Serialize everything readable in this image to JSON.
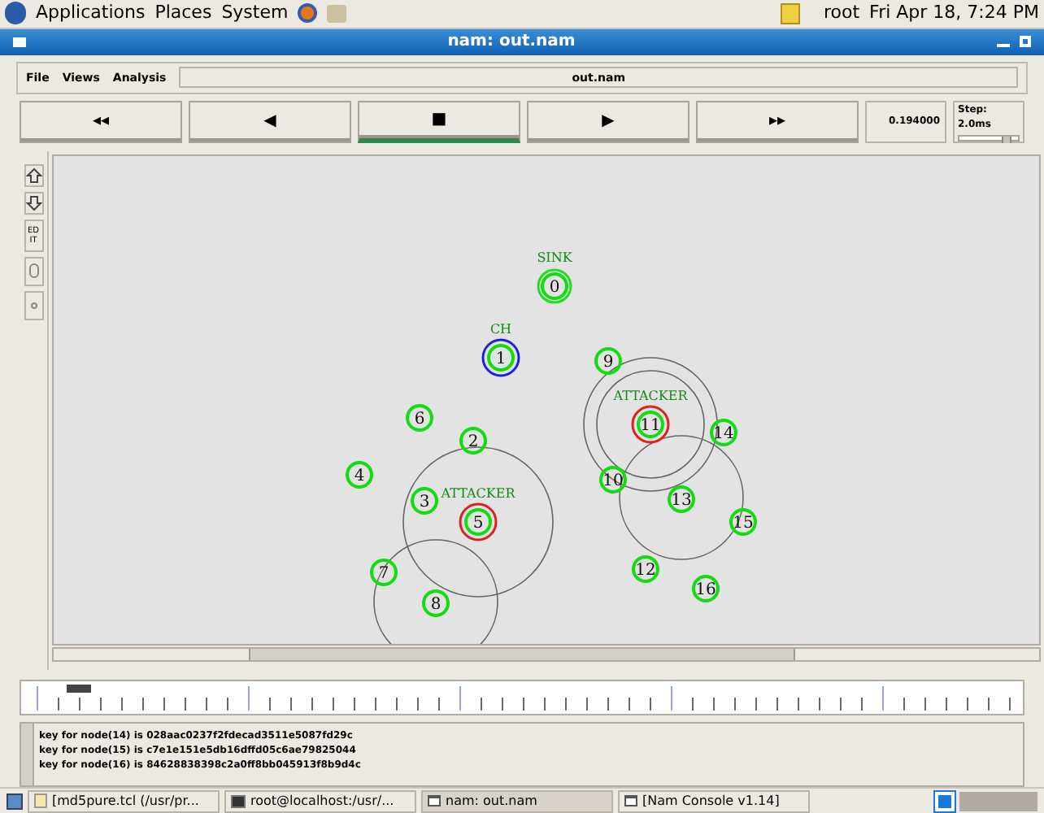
{
  "top_panel": {
    "menus": [
      "Applications",
      "Places",
      "System"
    ],
    "user": "root",
    "clock": "Fri Apr 18,  7:24 PM"
  },
  "window": {
    "title": "nam: out.nam"
  },
  "menu_bar": {
    "items": [
      "File",
      "Views",
      "Analysis"
    ],
    "file_name": "out.nam"
  },
  "controls": {
    "buttons": [
      {
        "label": "◂◂",
        "selected": false
      },
      {
        "label": "◀",
        "selected": false
      },
      {
        "label": "■",
        "selected": true
      },
      {
        "label": "▶",
        "selected": false
      },
      {
        "label": "▸▸",
        "selected": false
      }
    ],
    "time": "0.194000",
    "step": "Step: 2.0ms",
    "step_slider": {
      "level": 0.75
    }
  },
  "tools": [
    {
      "kind": "zoom-in"
    },
    {
      "kind": "zoom-out"
    },
    {
      "kind": "edit",
      "label": "ED IT"
    },
    {
      "kind": "big-circle"
    },
    {
      "kind": "small-circle"
    }
  ],
  "nodes": [
    {
      "label": "0",
      "tag": "SINK",
      "kind": "sink"
    },
    {
      "label": "1",
      "tag": "CH",
      "kind": "head"
    },
    {
      "label": "9",
      "kind": "normal"
    },
    {
      "label": "6",
      "kind": "normal"
    },
    {
      "label": "11",
      "tag": "ATTACKER",
      "kind": "attacker"
    },
    {
      "label": "2",
      "kind": "normal"
    },
    {
      "label": "14",
      "kind": "normal"
    },
    {
      "label": "4",
      "kind": "normal"
    },
    {
      "label": "10",
      "kind": "normal"
    },
    {
      "label": "3",
      "kind": "normal"
    },
    {
      "label": "5",
      "tag": "ATTACKER",
      "kind": "attacker"
    },
    {
      "label": "13",
      "kind": "normal"
    },
    {
      "label": "15",
      "kind": "normal"
    },
    {
      "label": "7",
      "kind": "normal"
    },
    {
      "label": "12",
      "kind": "normal"
    },
    {
      "label": "16",
      "kind": "normal"
    },
    {
      "label": "8",
      "kind": "normal"
    }
  ],
  "log": [
    "key for node(14) is 028aac0237f2fdecad3511e5087fd29c",
    "key for node(15) is c7e1e151e5db16dffd05c6ae79825044",
    "key for node(16) is 84628838398c2a0ff8bb045913f8b9d4c"
  ],
  "taskbar": [
    {
      "label": "[md5pure.tcl (/usr/pr...",
      "kind": "editor",
      "selected": false
    },
    {
      "label": "root@localhost:/usr/...",
      "kind": "terminal",
      "selected": false
    },
    {
      "label": "nam: out.nam",
      "kind": "window",
      "selected": true
    },
    {
      "label": "[Nam Console v1.14]",
      "kind": "window",
      "selected": false
    }
  ]
}
